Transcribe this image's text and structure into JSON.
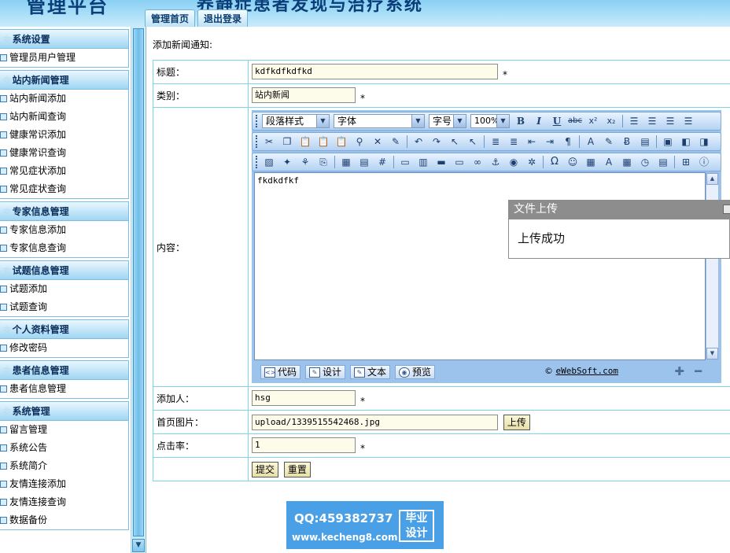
{
  "header": {
    "logo_text": "管理平台",
    "system_title": "养静症患者发现与治疗系统",
    "tabs": [
      "管理首页",
      "退出登录"
    ]
  },
  "sidebar": {
    "groups": [
      {
        "title": "系统设置",
        "items": [
          "管理员用户管理"
        ]
      },
      {
        "title": "站内新闻管理",
        "items": [
          "站内新闻添加",
          "站内新闻查询",
          "健康常识添加",
          "健康常识查询",
          "常见症状添加",
          "常见症状查询"
        ]
      },
      {
        "title": "专家信息管理",
        "items": [
          "专家信息添加",
          "专家信息查询"
        ]
      },
      {
        "title": "试题信息管理",
        "items": [
          "试题添加",
          "试题查询"
        ]
      },
      {
        "title": "个人资料管理",
        "items": [
          "修改密码"
        ]
      },
      {
        "title": "患者信息管理",
        "items": [
          "患者信息管理"
        ]
      },
      {
        "title": "系统管理",
        "items": [
          "留言管理",
          "系统公告",
          "系统简介",
          "友情连接添加",
          "友情连接查询",
          "数据备份"
        ]
      }
    ]
  },
  "main": {
    "breadcrumb": "添加新闻通知:",
    "form": {
      "title_label": "标题：",
      "title_value": "kdfkdfkdfkd",
      "category_label": "类别：",
      "category_value": "站内新闻",
      "content_label": "内容：",
      "content_value": "fkdkdfkf",
      "author_label": "添加人：",
      "author_value": "hsg",
      "image_label": "首页图片：",
      "image_value": "upload/1339515542468.jpg",
      "upload_button": "上传",
      "hits_label": "点击率：",
      "hits_value": "1",
      "required_mark": "*",
      "submit_button": "提交",
      "reset_button": "重置"
    },
    "editor": {
      "paragraph_style": "段落样式",
      "font": "字体",
      "font_size": "字号",
      "zoom": "100%",
      "modes": [
        "代码",
        "设计",
        "文本",
        "预览"
      ],
      "copyright_symbol": "©",
      "copyright_link": "eWebSoft.com"
    }
  },
  "popup": {
    "title": "文件上传",
    "message": "上传成功"
  },
  "badge": {
    "qq": "QQ:459382737",
    "site": "www.kecheng8.com",
    "box_line1": "毕业",
    "box_line2": "设计"
  },
  "colors": {
    "accent": "#7fbde0",
    "table_border": "#7fd3e6",
    "input_bg": "#fdfbea",
    "badge_bg": "#4aa0e6"
  }
}
